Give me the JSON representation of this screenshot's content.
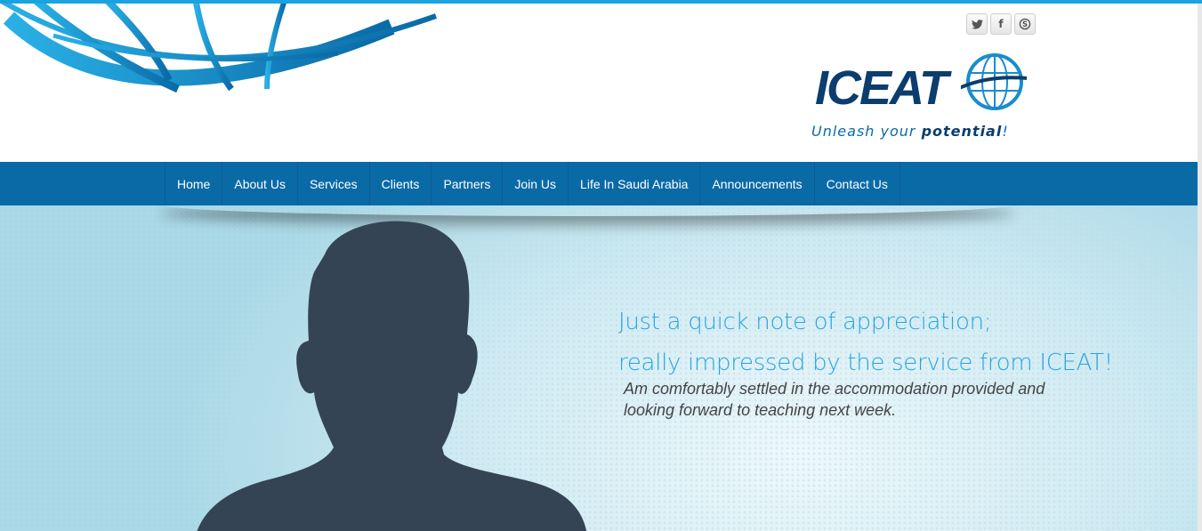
{
  "header": {
    "logo_text": "ICEAT",
    "tagline_pre": "Unleash your ",
    "tagline_bold": "potential",
    "tagline_end": "!",
    "social": [
      {
        "icon": "twitter-icon",
        "glyph": "🐦"
      },
      {
        "icon": "facebook-icon",
        "glyph": "f"
      },
      {
        "icon": "skype-icon",
        "glyph": "S"
      }
    ]
  },
  "nav": {
    "items": [
      "Home",
      "About Us",
      "Services",
      "Clients",
      "Partners",
      "Join Us",
      "Life In Saudi Arabia",
      "Announcements",
      "Contact Us"
    ]
  },
  "hero": {
    "line1": "Just a quick note of appreciation;",
    "line2": "really impressed by the service from ICEAT!",
    "body": "Am comfortably settled in the accommodation provided and looking forward to teaching next week."
  },
  "colors": {
    "brand_dark": "#0b3d6e",
    "nav_bg": "#0a6aa6",
    "accent": "#2aa4dd",
    "silhouette": "#344454"
  }
}
